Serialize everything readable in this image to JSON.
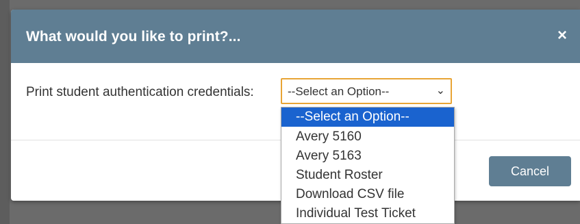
{
  "dialog": {
    "title": "What would you like to print?...",
    "close_glyph": "×",
    "cancel_label": "Cancel"
  },
  "field": {
    "label": "Print student authentication credentials:",
    "value": "--Select an Option--",
    "caret_icon": "chevron-down-icon"
  },
  "options": [
    "--Select an Option--",
    "Avery 5160",
    "Avery 5163",
    "Student Roster",
    "Download CSV file",
    "Individual Test Ticket"
  ],
  "selected_option": "--Select an Option--",
  "colors": {
    "header": "#5f7e93",
    "focus_border": "#e8a435",
    "selected_option_bg": "#1a63cf",
    "backdrop": "#6b6b6b"
  }
}
